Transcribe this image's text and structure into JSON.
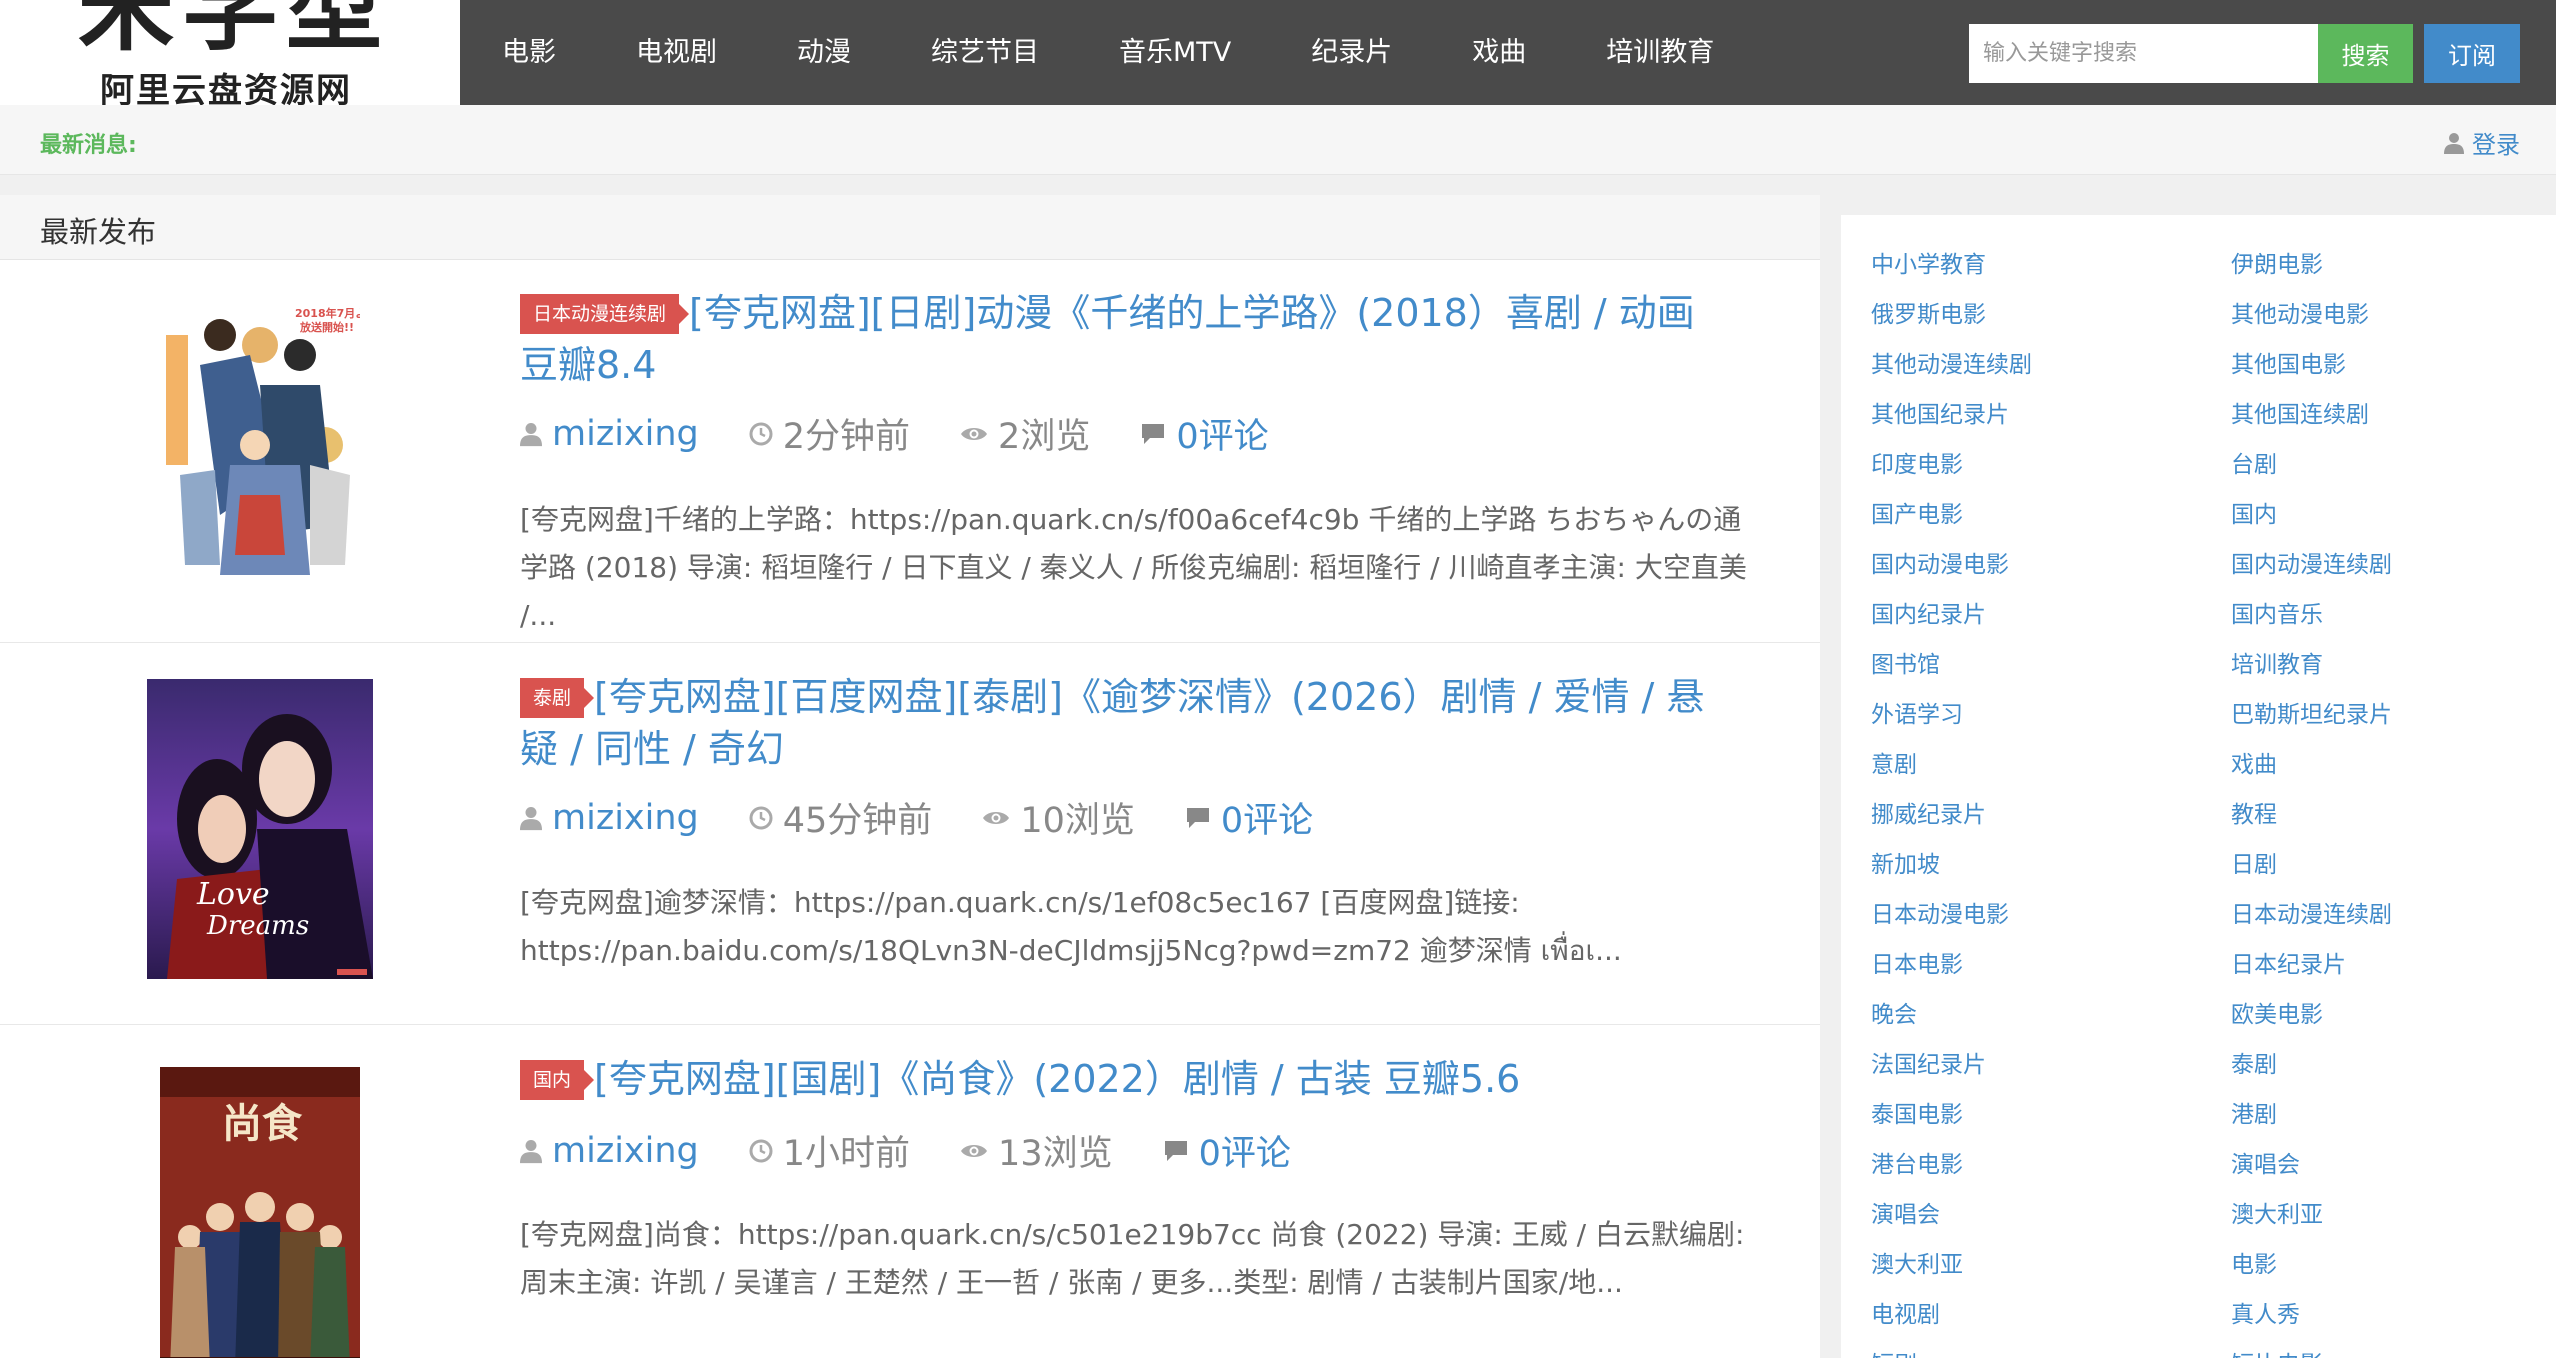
{
  "logo": {
    "big": "米学型",
    "sub": "阿里云盘资源网"
  },
  "nav": {
    "items": [
      "电影",
      "电视剧",
      "动漫",
      "综艺节目",
      "音乐MTV",
      "纪录片",
      "戏曲",
      "培训教育"
    ]
  },
  "search": {
    "placeholder": "输入关键字搜索",
    "button": "搜索",
    "subscribe": "订阅"
  },
  "newsbar": {
    "label": "最新消息:",
    "login": "登录"
  },
  "main": {
    "section_title": "最新发布",
    "posts": [
      {
        "category": "日本动漫连续剧",
        "title": "[夸克网盘][日剧]动漫《千绪的上学路》(2018）喜剧 / 动画 豆瓣8.4",
        "author": "mizixing",
        "time": "2分钟前",
        "views": "2浏览",
        "comments": "0评论",
        "excerpt": "[夸克网盘]千绪的上学路：https://pan.quark.cn/s/f00a6cef4c9b 千绪的上学路 ちおちゃんの通学路 (2018) 导演: 稻垣隆行 / 日下直义 / 秦义人 / 所俊克编剧: 稻垣隆行 / 川崎直孝主演: 大空直美 /...",
        "poster_text": "2018年7月より放送開始!!"
      },
      {
        "category": "泰剧",
        "title": "[夸克网盘][百度网盘][泰剧]《逾梦深情》(2026）剧情 / 爱情 / 悬疑 / 同性 / 奇幻",
        "author": "mizixing",
        "time": "45分钟前",
        "views": "10浏览",
        "comments": "0评论",
        "excerpt": "[夸克网盘]逾梦深情：https://pan.quark.cn/s/1ef08c5ec167 [百度网盘]链接: https://pan.baidu.com/s/18QLvn3N-deCJldmsjj5Ncg?pwd=zm72 逾梦深情 เพื่อเ...",
        "poster_text": "Love Dreams"
      },
      {
        "category": "国内",
        "title": "[夸克网盘][国剧]《尚食》(2022）剧情 / 古装 豆瓣5.6",
        "author": "mizixing",
        "time": "1小时前",
        "views": "13浏览",
        "comments": "0评论",
        "excerpt": "[夸克网盘]尚食：https://pan.quark.cn/s/c501e219b7cc 尚食 (2022) 导演: 王威 / 白云默编剧: 周末主演: 许凯 / 吴谨言 / 王楚然 / 王一哲 / 张南 / 更多...类型: 剧情 / 古装制片国家/地...",
        "poster_text": "尚食"
      }
    ]
  },
  "sidebar": {
    "tags": [
      "中小学教育",
      "伊朗电影",
      "俄罗斯电影",
      "其他动漫电影",
      "其他动漫连续剧",
      "其他国电影",
      "其他国纪录片",
      "其他国连续剧",
      "印度电影",
      "台剧",
      "国产电影",
      "国内",
      "国内动漫电影",
      "国内动漫连续剧",
      "国内纪录片",
      "国内音乐",
      "图书馆",
      "培训教育",
      "外语学习",
      "巴勒斯坦纪录片",
      "意剧",
      "戏曲",
      "挪威纪录片",
      "教程",
      "新加坡",
      "日剧",
      "日本动漫电影",
      "日本动漫连续剧",
      "日本电影",
      "日本纪录片",
      "晚会",
      "欧美电影",
      "法国纪录片",
      "泰剧",
      "泰国电影",
      "港剧",
      "港台电影",
      "演唱会",
      "演唱会",
      "澳大利亚",
      "澳大利亚",
      "电影",
      "电视剧",
      "真人秀",
      "短剧",
      "短片电影"
    ]
  },
  "colors": {
    "header_bg": "#4a4a4a",
    "link": "#428bca",
    "search_btn": "#5cb85c",
    "subscribe_btn": "#428bca",
    "badge": "#d9534f",
    "news_label": "#5cb85c"
  },
  "icons": {
    "author": "user-icon",
    "time": "clock-icon",
    "views": "eye-icon",
    "comments": "comment-icon",
    "login": "user-icon"
  }
}
